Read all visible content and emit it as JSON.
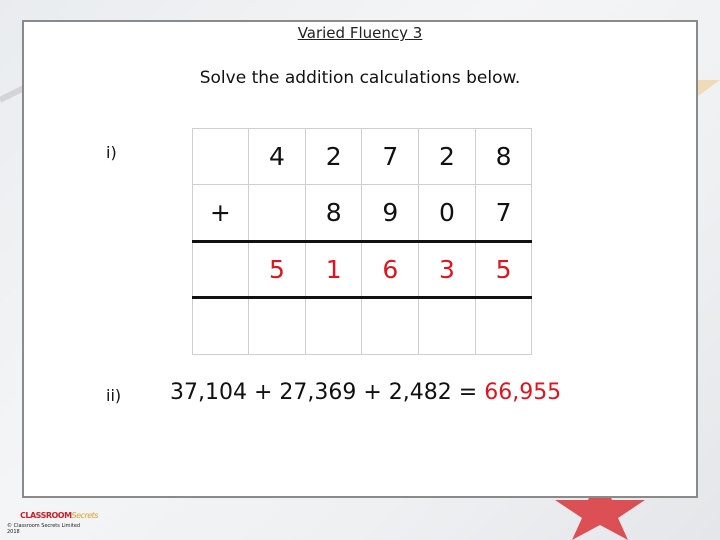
{
  "title": "Varied Fluency 3",
  "instruction": "Solve the addition calculations below.",
  "q1": {
    "label": "i)",
    "rows": [
      [
        "",
        "4",
        "2",
        "7",
        "2",
        "8"
      ],
      [
        "+",
        "",
        "8",
        "9",
        "0",
        "7"
      ],
      [
        "",
        "5",
        "1",
        "6",
        "3",
        "5"
      ],
      [
        "",
        "",
        "",
        "",
        "",
        ""
      ]
    ]
  },
  "q2": {
    "label": "ii)",
    "equation": "37,104 + 27,369 + 2,482 = ",
    "answer": "66,955"
  },
  "footer": {
    "logo_main": "CLASSROOM",
    "logo_sub": "Secrets",
    "copyright": "© Classroom Secrets Limited",
    "year": "2018"
  },
  "colors": {
    "answer": "#e0141e",
    "panel_border": "#8a8a8a"
  }
}
